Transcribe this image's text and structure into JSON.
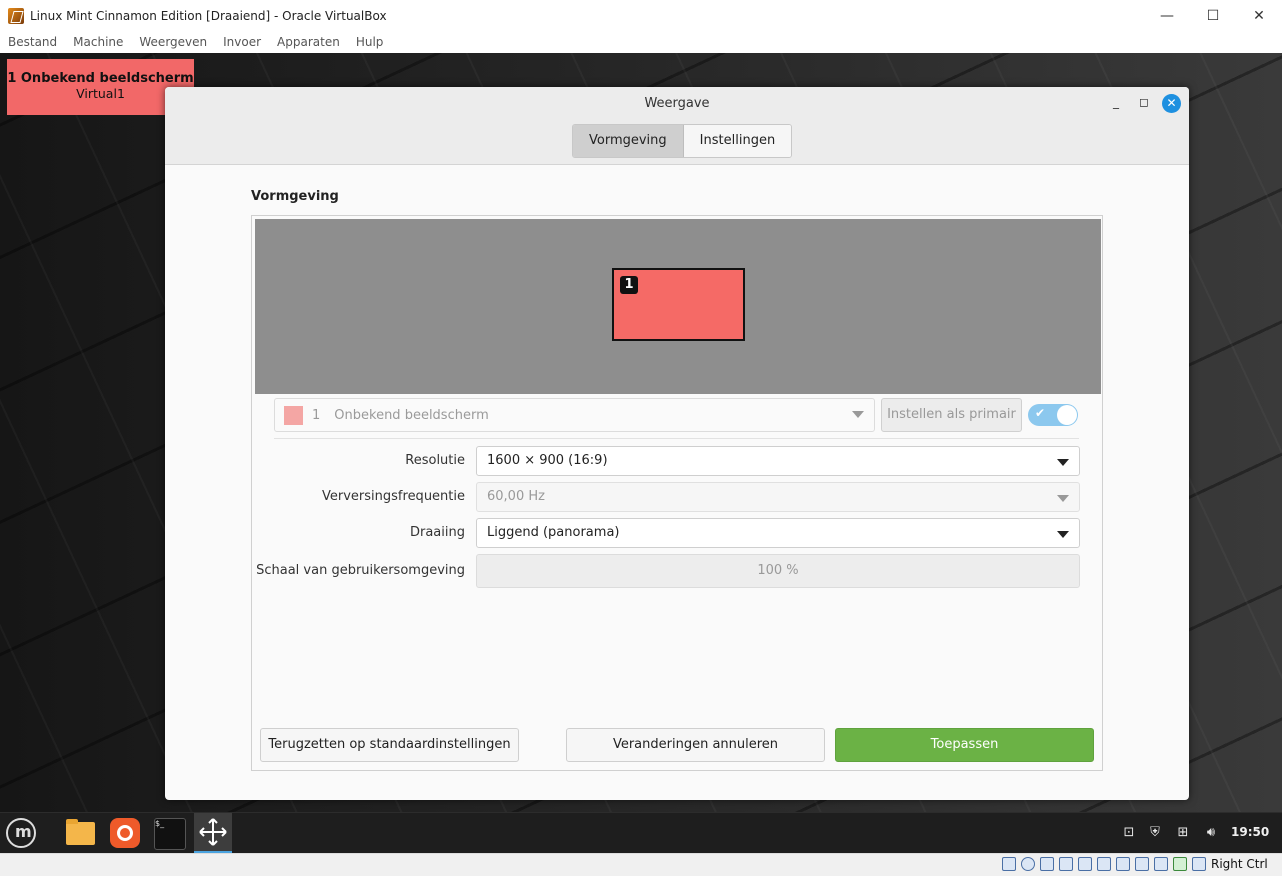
{
  "host": {
    "title": "Linux Mint Cinnamon Edition [Draaiend] - Oracle VirtualBox",
    "menu": [
      "Bestand",
      "Machine",
      "Weergeven",
      "Invoer",
      "Apparaten",
      "Hulp"
    ],
    "host_key": "Right Ctrl"
  },
  "osd": {
    "line1": "1  Onbekend beeldscherm",
    "line2": "Virtual1",
    "color": "#f26868"
  },
  "dialog": {
    "title": "Weergave",
    "tabs": [
      {
        "label": "Vormgeving",
        "active": true
      },
      {
        "label": "Instellingen",
        "active": false
      }
    ],
    "section_title": "Vormgeving",
    "monitor_badge": "1",
    "monitor_select": {
      "number": "1",
      "name": "Onbekend beeldscherm"
    },
    "primary_button": "Instellen als primair",
    "monitor_enabled": true,
    "fields": {
      "resolution": {
        "label": "Resolutie",
        "value": "1600 × 900 (16:9)"
      },
      "refresh": {
        "label": "Verversingsfrequentie",
        "value": "60,00 Hz"
      },
      "rotation": {
        "label": "Draaiing",
        "value": "Liggend (panorama)"
      },
      "scale": {
        "label": "Schaal van gebruikersomgeving",
        "value": "100 %"
      }
    },
    "buttons": {
      "reset": "Terugzetten op standaardinstellingen",
      "cancel": "Veranderingen annuleren",
      "apply": "Toepassen"
    },
    "colors": {
      "accent": "#1e90e0",
      "apply": "#6bb245",
      "monitor": "#f56a66"
    }
  },
  "taskbar": {
    "apps": [
      "menu-icon",
      "files-icon",
      "firefox-icon",
      "terminal-icon",
      "display-settings-icon"
    ],
    "tray": [
      "update-icon",
      "shield-icon",
      "network-icon",
      "volume-icon"
    ],
    "clock": "19:50"
  }
}
